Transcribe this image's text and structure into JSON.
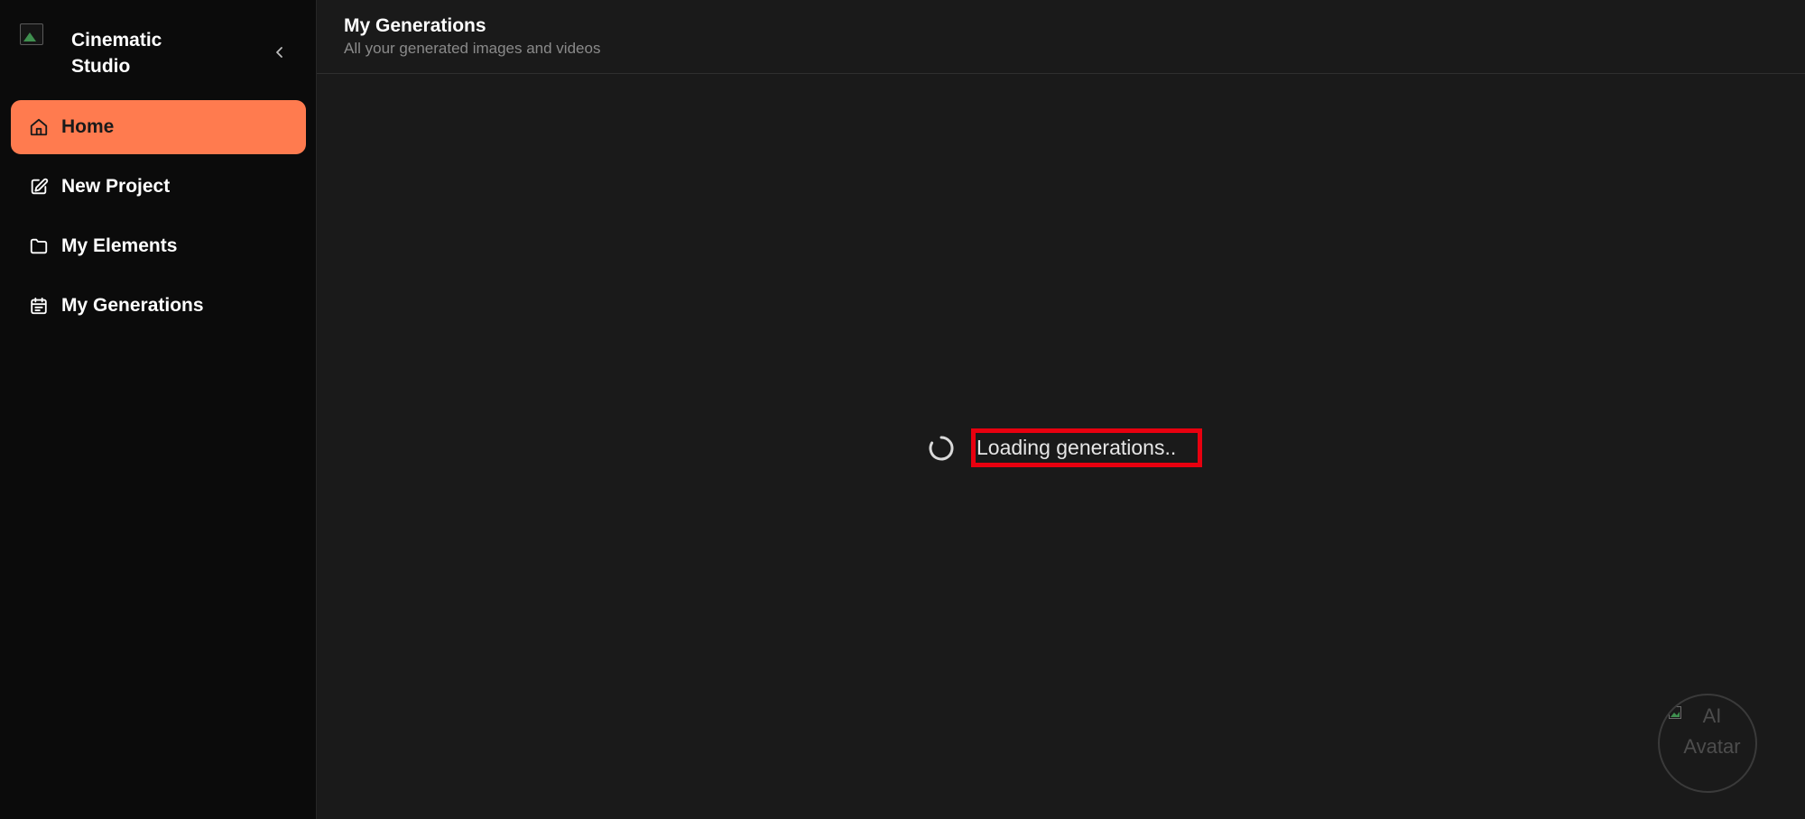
{
  "brand": {
    "name": "Cinematic Studio",
    "logo_icon": "image-placeholder-icon"
  },
  "sidebar": {
    "collapse_icon": "chevron-left-icon",
    "items": [
      {
        "label": "Home",
        "icon": "home-icon",
        "active": true
      },
      {
        "label": "New Project",
        "icon": "edit-icon",
        "active": false
      },
      {
        "label": "My Elements",
        "icon": "folder-icon",
        "active": false
      },
      {
        "label": "My Generations",
        "icon": "calendar-list-icon",
        "active": false
      }
    ]
  },
  "header": {
    "title": "My Generations",
    "subtitle": "All your generated images and videos"
  },
  "loading": {
    "text": "Loading generations..",
    "highlight_color": "#e8000f"
  },
  "avatar": {
    "alt": "AI Avatar"
  },
  "colors": {
    "accent": "#ff7b4f",
    "sidebar_bg": "#0b0b0b",
    "main_bg": "#1a1a1a"
  }
}
